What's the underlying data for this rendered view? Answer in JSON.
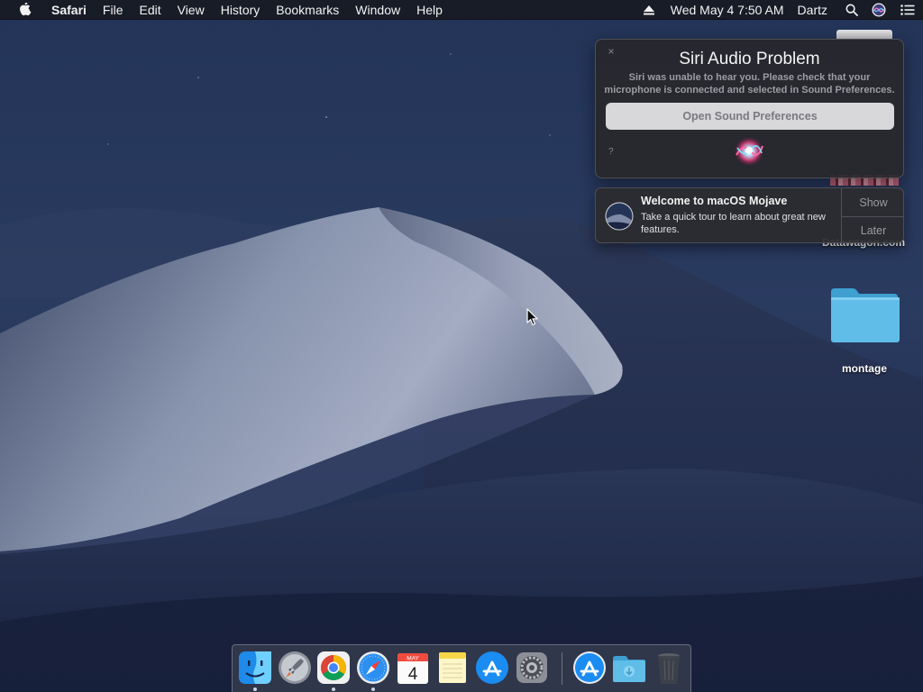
{
  "menubar": {
    "apple_icon": "apple-icon",
    "app_name": "Safari",
    "menus": [
      "File",
      "Edit",
      "View",
      "History",
      "Bookmarks",
      "Window",
      "Help"
    ],
    "clock": "Wed May 4  7:50 AM",
    "user": "Dartz",
    "status_icons": [
      "eject-icon",
      "search-icon",
      "siri-icon",
      "notification-center-icon"
    ]
  },
  "desktop": {
    "icons": [
      {
        "label": "Datawagon.com",
        "icon": "web-location-icon"
      },
      {
        "label": "montage",
        "icon": "folder-icon"
      }
    ]
  },
  "siri_alert": {
    "close_icon": "close-icon",
    "title": "Siri Audio Problem",
    "message": "Siri was unable to hear you. Please check that your microphone is connected and selected in Sound Preferences.",
    "button_label": "Open Sound Preferences",
    "help_label": "?",
    "orb_icon": "siri-orb-icon"
  },
  "notification": {
    "icon": "macos-mojave-icon",
    "title": "Welcome to macOS Mojave",
    "body": "Take a quick tour to learn about great new features.",
    "actions": [
      "Show",
      "Later"
    ]
  },
  "dock": {
    "items": [
      {
        "name": "finder-icon",
        "running": true
      },
      {
        "name": "launchpad-icon",
        "running": false
      },
      {
        "name": "chrome-icon",
        "running": true
      },
      {
        "name": "safari-icon",
        "running": true
      },
      {
        "name": "calendar-icon",
        "running": false,
        "month": "MAY",
        "day": "4"
      },
      {
        "name": "notes-icon",
        "running": false
      },
      {
        "name": "app-store-icon",
        "running": false
      },
      {
        "name": "system-preferences-icon",
        "running": false
      },
      {
        "name": "app-store-downloads-icon",
        "running": false
      },
      {
        "name": "downloads-folder-icon",
        "running": false
      },
      {
        "name": "trash-icon",
        "running": false
      }
    ]
  },
  "colors": {
    "sky": "#1b2848",
    "dune_light": "#7f8ba6",
    "dune_dark": "#2a3553",
    "folder": "#5fbde8"
  }
}
